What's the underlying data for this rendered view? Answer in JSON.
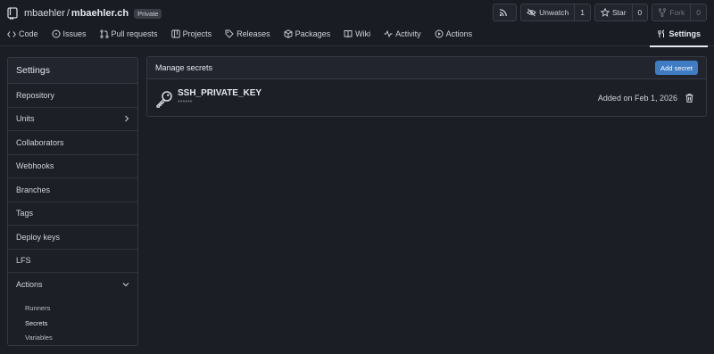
{
  "repo": {
    "owner": "mbaehler",
    "separator": "/",
    "name": "mbaehler.ch",
    "visibility": "Private"
  },
  "actions": {
    "rss_icon": "rss-icon",
    "unwatch_label": "Unwatch",
    "unwatch_count": "1",
    "star_label": "Star",
    "star_count": "0",
    "fork_label": "Fork",
    "fork_count": "0"
  },
  "tabs": [
    {
      "label": "Code",
      "icon": "code-icon"
    },
    {
      "label": "Issues",
      "icon": "issues-icon"
    },
    {
      "label": "Pull requests",
      "icon": "pull-request-icon"
    },
    {
      "label": "Projects",
      "icon": "projects-icon"
    },
    {
      "label": "Releases",
      "icon": "tag-icon"
    },
    {
      "label": "Packages",
      "icon": "package-icon"
    },
    {
      "label": "Wiki",
      "icon": "book-icon"
    },
    {
      "label": "Activity",
      "icon": "pulse-icon"
    },
    {
      "label": "Actions",
      "icon": "play-icon"
    }
  ],
  "settings_tab": {
    "label": "Settings",
    "icon": "tools-icon"
  },
  "sidebar": {
    "title": "Settings",
    "items": [
      {
        "label": "Repository"
      },
      {
        "label": "Units"
      },
      {
        "label": "Collaborators"
      },
      {
        "label": "Webhooks"
      },
      {
        "label": "Branches"
      },
      {
        "label": "Tags"
      },
      {
        "label": "Deploy keys"
      },
      {
        "label": "LFS"
      },
      {
        "label": "Actions"
      }
    ],
    "sub_items": [
      {
        "label": "Runners"
      },
      {
        "label": "Secrets"
      },
      {
        "label": "Variables"
      }
    ]
  },
  "panel": {
    "title": "Manage secrets",
    "add_button": "Add secret",
    "secret": {
      "name": "SSH_PRIVATE_KEY",
      "mask": "******",
      "added": "Added on Feb 1, 2026"
    }
  },
  "colors": {
    "background": "#1c1e26",
    "accent": "#3f7cc4"
  }
}
